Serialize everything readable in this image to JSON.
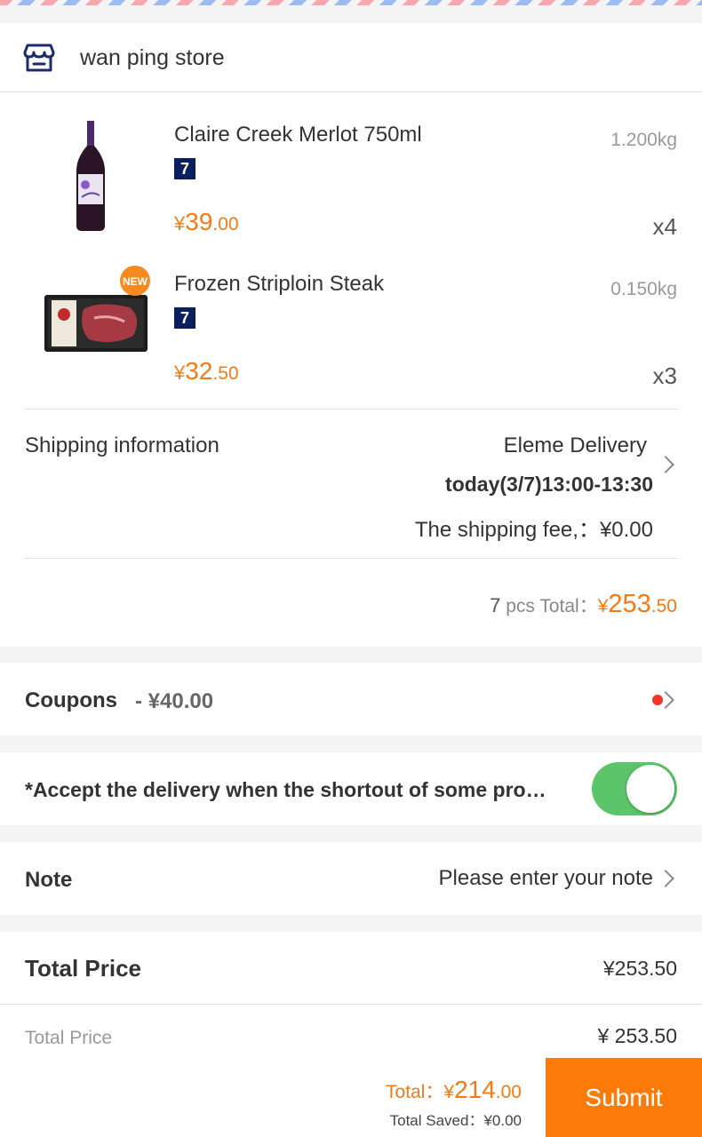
{
  "store": {
    "name": "wan ping store",
    "icon": "store-icon"
  },
  "items": [
    {
      "name": "Claire Creek Merlot 750ml",
      "badge": "7",
      "weight": "1.200kg",
      "price_currency": "¥",
      "price_int": "39",
      "price_dec": ".00",
      "qty": "x4"
    },
    {
      "name": "Frozen Striploin Steak",
      "badge": "7",
      "weight": "0.150kg",
      "price_currency": "¥",
      "price_int": "32",
      "price_dec": ".50",
      "qty": "x3",
      "new_badge": "NEW"
    }
  ],
  "shipping": {
    "label": "Shipping information",
    "carrier": "Eleme Delivery",
    "time": "today(3/7)13:00-13:30",
    "fee_label": "The shipping fee,：",
    "fee_value": "¥0.00"
  },
  "summary": {
    "count": "7",
    "pcs_label": " pcs Total：",
    "currency": "¥",
    "int": "253",
    "dec": ".50"
  },
  "coupons": {
    "label": "Coupons",
    "amount": "- ¥40.00"
  },
  "accept": {
    "label": "*Accept the delivery when the shortout of some pro…",
    "enabled": true
  },
  "note": {
    "label": "Note",
    "placeholder": "Please enter your note"
  },
  "total_price": {
    "label": "Total Price",
    "value": "¥253.50"
  },
  "bottom": {
    "label": "Total Price",
    "value": "¥ 253.50",
    "total_label": "Total：",
    "total_currency": "¥",
    "total_int": "214",
    "total_dec": ".00",
    "saved_label": "Total Saved：",
    "saved_value": "¥0.00",
    "submit": "Submit"
  },
  "colors": {
    "accent": "#f27b16",
    "submit": "#fa7a0a",
    "toggle_on": "#5cc46a",
    "badge": "#0b1f5e"
  }
}
